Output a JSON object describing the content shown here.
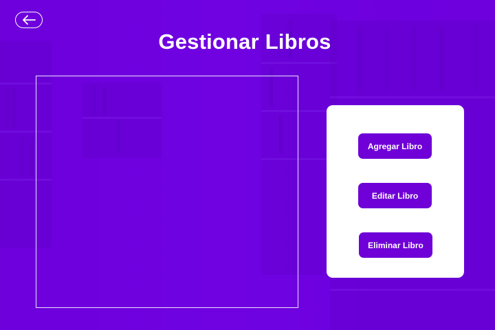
{
  "header": {
    "back_icon": "arrow-left-icon",
    "title": "Gestionar Libros"
  },
  "actions": {
    "add_label": "Agregar Libro",
    "edit_label": "Editar Libro",
    "delete_label": "Eliminar Libro"
  },
  "colors": {
    "background": "#6a00d8",
    "accent": "#6f00d7",
    "panel": "#ffffff",
    "text_on_accent": "#ffffff"
  }
}
